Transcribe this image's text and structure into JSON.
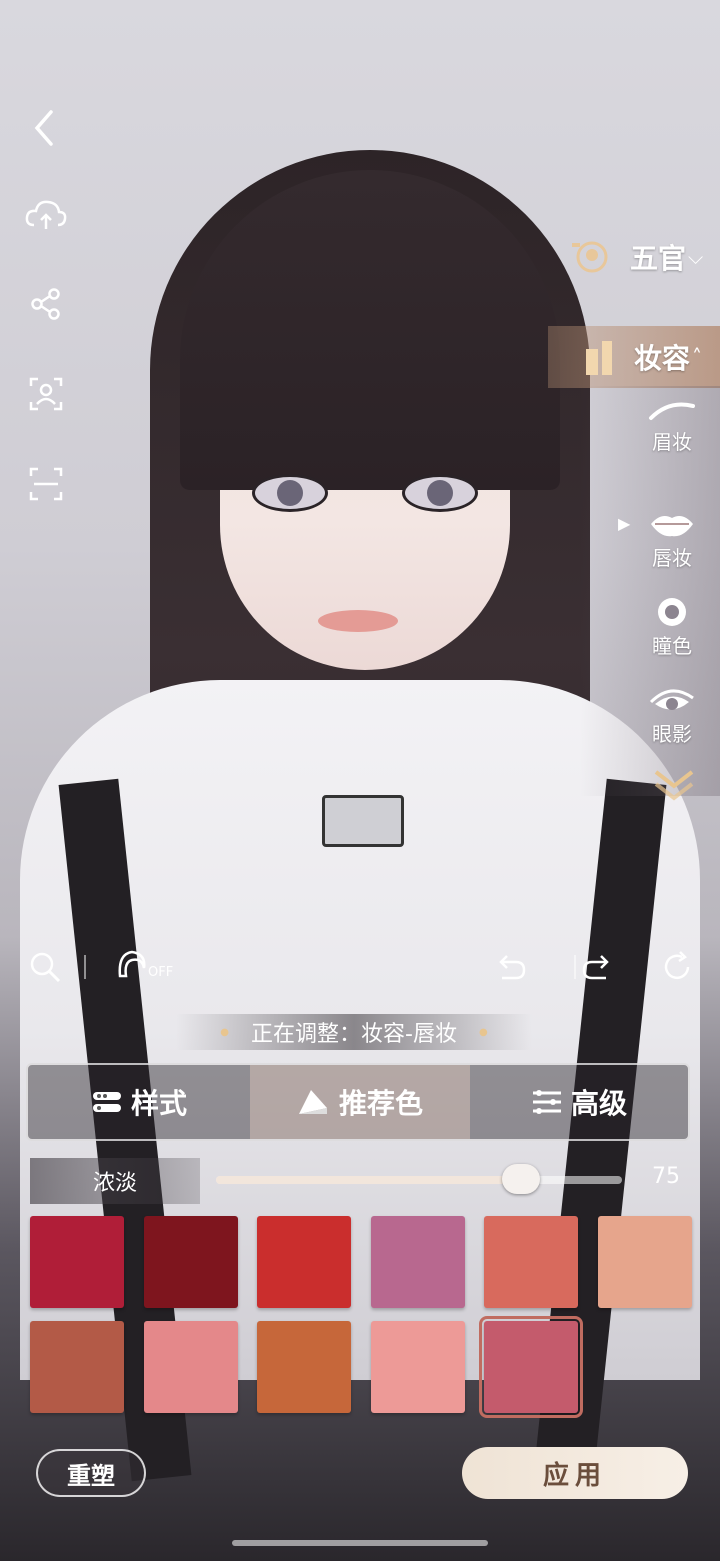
{
  "category": {
    "features_label": "五官",
    "makeup_label": "妆容"
  },
  "makeup_items": [
    {
      "label": "眉妆",
      "icon": "eyebrow-icon"
    },
    {
      "label": "唇妆",
      "icon": "lips-icon",
      "selected": true
    },
    {
      "label": "瞳色",
      "icon": "pupil-icon"
    },
    {
      "label": "眼影",
      "icon": "eyeshadow-icon"
    }
  ],
  "left_icons": [
    "back-icon",
    "cloud-upload-icon",
    "share-icon",
    "face-scan-icon",
    "screenshot-icon"
  ],
  "toolbar": {
    "hair_toggle_text": "OFF"
  },
  "status": {
    "adjusting_text": "正在调整：妆容-唇妆"
  },
  "tabs": [
    {
      "label": "样式",
      "icon": "style-icon"
    },
    {
      "label": "推荐色",
      "icon": "palette-icon",
      "active": true
    },
    {
      "label": "高级",
      "icon": "sliders-icon"
    }
  ],
  "intensity": {
    "label": "浓淡",
    "value": "75",
    "fraction": 0.75
  },
  "swatches": [
    {
      "color": "#b01e38"
    },
    {
      "color": "#7e151e"
    },
    {
      "color": "#ca2e2d"
    },
    {
      "color": "#b8688f"
    },
    {
      "color": "#d86a5d"
    },
    {
      "color": "#e6a58c"
    },
    {
      "color": "#b35a47"
    },
    {
      "color": "#e4888a"
    },
    {
      "color": "#c6673a"
    },
    {
      "color": "#ed9a97"
    },
    {
      "color": "#c45b6c",
      "selected": true
    }
  ],
  "buttons": {
    "reset": "重塑",
    "apply": "应用"
  }
}
